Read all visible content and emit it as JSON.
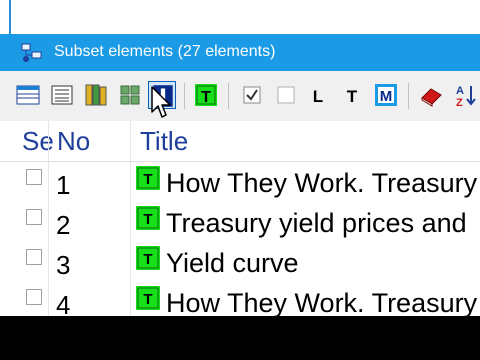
{
  "window": {
    "title": "Subset elements (27 elements)",
    "title_icon": "subset-tree-icon"
  },
  "toolbar": {
    "buttons": [
      {
        "icon": "list-rows-icon"
      },
      {
        "icon": "details-view-icon"
      },
      {
        "icon": "books-icon"
      },
      {
        "icon": "tiles-view-icon"
      },
      {
        "icon": "level-i-icon",
        "active": true
      },
      {
        "icon": "type-t-green-icon"
      },
      {
        "icon": "checkbox-checked-icon"
      },
      {
        "icon": "checkbox-empty-icon"
      },
      {
        "icon": "letter-l-icon"
      },
      {
        "icon": "letter-t-icon"
      },
      {
        "icon": "letter-m-icon"
      },
      {
        "icon": "eraser-icon"
      },
      {
        "icon": "sort-az-icon"
      }
    ]
  },
  "columns": {
    "sel": "Se",
    "no": "No",
    "title": "Title"
  },
  "rows": [
    {
      "no": "1",
      "title": "How They Work. Treasury"
    },
    {
      "no": "2",
      "title": "Treasury yield prices and"
    },
    {
      "no": "3",
      "title": "Yield curve"
    },
    {
      "no": "4",
      "title": "How They Work. Treasury"
    }
  ],
  "colors": {
    "titlebar": "#1b9ae6",
    "header_text": "#1f3f9a",
    "type_icon": "#17e01a"
  }
}
